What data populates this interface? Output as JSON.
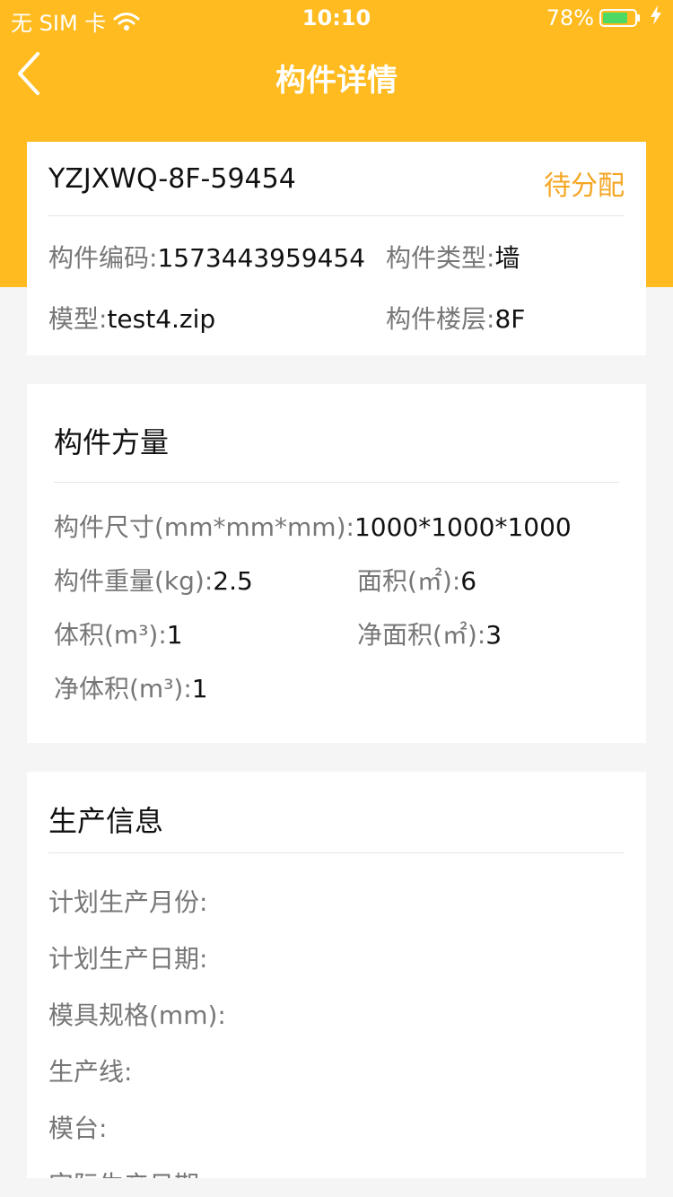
{
  "status_bar": {
    "carrier": "无 SIM 卡",
    "time": "10:10",
    "battery": "78%",
    "wifi_icon": "wifi-icon",
    "battery_icon": "battery-icon",
    "charging_icon": "charging-bolt-icon"
  },
  "nav": {
    "title": "构件详情",
    "back_icon": "chevron-left-icon"
  },
  "colors": {
    "header": "#ffbb1f",
    "status_badge": "#f5a623",
    "background": "#f5f5f5"
  },
  "component": {
    "name": "YZJXWQ-8F-59454",
    "status": "待分配",
    "code_label": "构件编码:",
    "code_value": "1573443959454",
    "type_label": "构件类型:",
    "type_value": "墙",
    "model_label": "模型:",
    "model_value": "test4.zip",
    "floor_label": "构件楼层:",
    "floor_value": "8F"
  },
  "quantity": {
    "title": "构件方量",
    "size_label": "构件尺寸(mm*mm*mm):",
    "size_value": "1000*1000*1000",
    "weight_label": "构件重量(kg):",
    "weight_value": "2.5",
    "area_label": "面积(㎡):",
    "area_value": "6",
    "volume_label": "体积(m³):",
    "volume_value": "1",
    "net_area_label": "净面积(㎡):",
    "net_area_value": "3",
    "net_volume_label": "净体积(m³):",
    "net_volume_value": "1"
  },
  "production": {
    "title": "生产信息",
    "rows": [
      "计划生产月份:",
      "计划生产日期:",
      "模具规格(mm):",
      "生产线:",
      "模台:",
      "实际生产日期:"
    ]
  }
}
